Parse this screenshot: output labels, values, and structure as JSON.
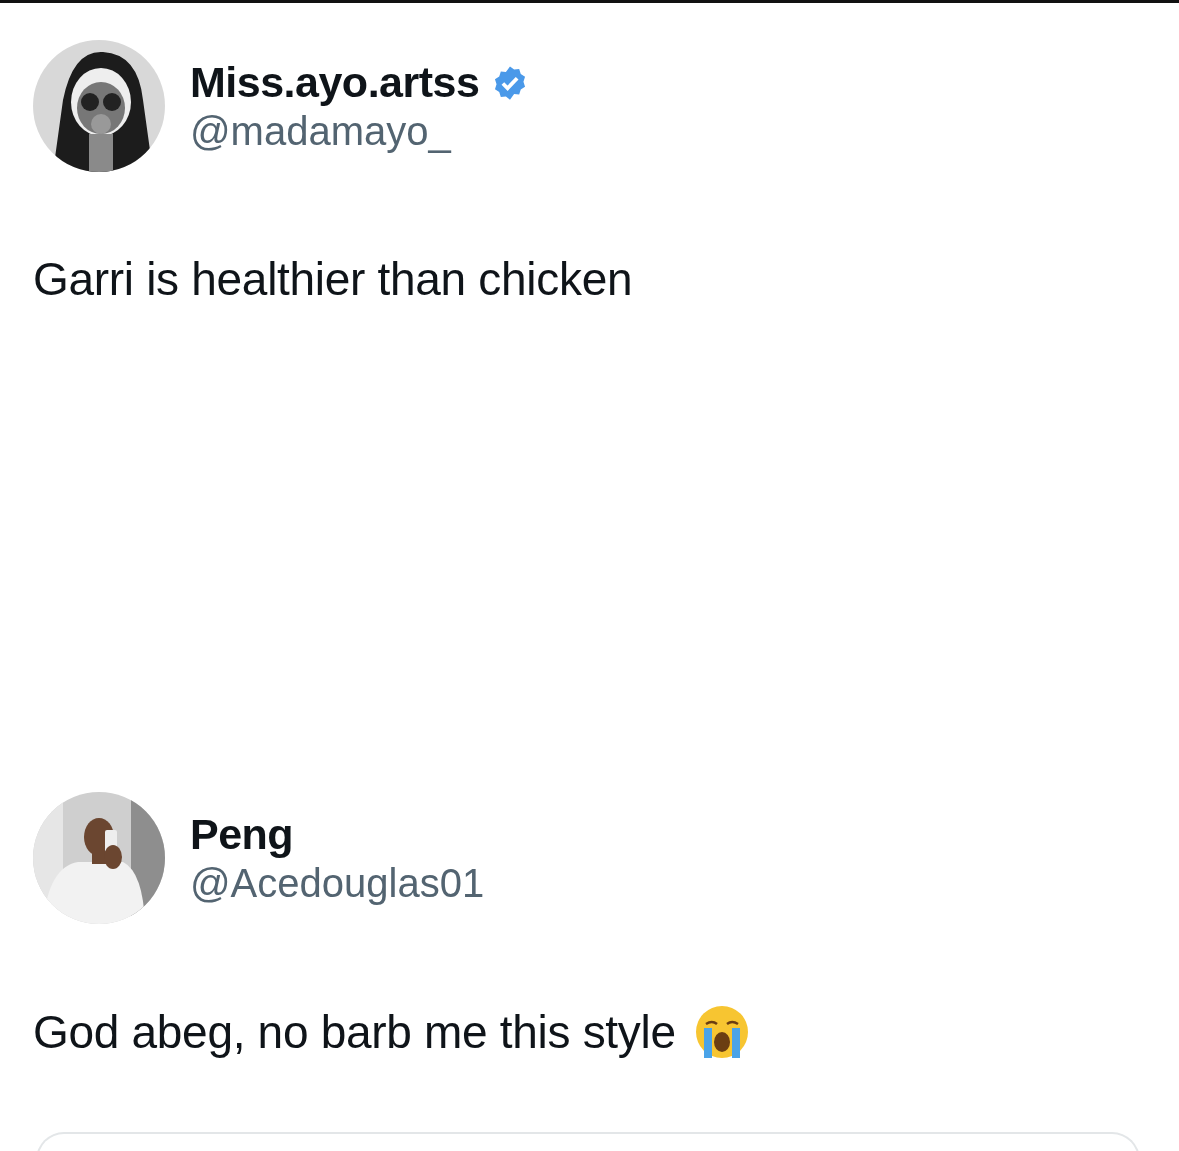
{
  "posts": [
    {
      "name": "Miss.ayo.artss",
      "verified": true,
      "handle": "@madamayo_",
      "text": "Garri is healthier than chicken",
      "emoji": false
    },
    {
      "name": "Peng",
      "verified": false,
      "handle": "@Acedouglas01",
      "text": "God abeg, no barb me this style",
      "emoji": true
    }
  ],
  "reply_box": {
    "kind": "outline"
  }
}
